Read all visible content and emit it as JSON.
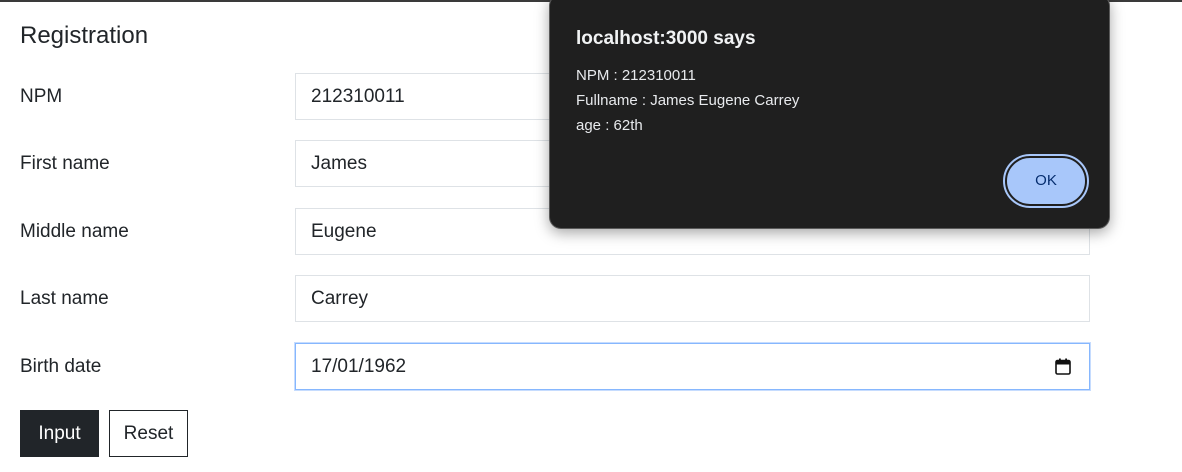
{
  "form": {
    "title": "Registration",
    "fields": [
      {
        "label": "NPM",
        "value": "212310011"
      },
      {
        "label": "First name",
        "value": "James"
      },
      {
        "label": "Middle name",
        "value": "Eugene"
      },
      {
        "label": "Last name",
        "value": "Carrey"
      },
      {
        "label": "Birth date",
        "value": "17/01/1962"
      }
    ],
    "input_button": "Input",
    "reset_button": "Reset"
  },
  "dialog": {
    "title": "localhost:3000 says",
    "lines": [
      "NPM : 212310011",
      "Fullname : James Eugene Carrey",
      "age : 62th"
    ],
    "ok_label": "OK"
  },
  "icons": {
    "calendar": "calendar-icon"
  }
}
